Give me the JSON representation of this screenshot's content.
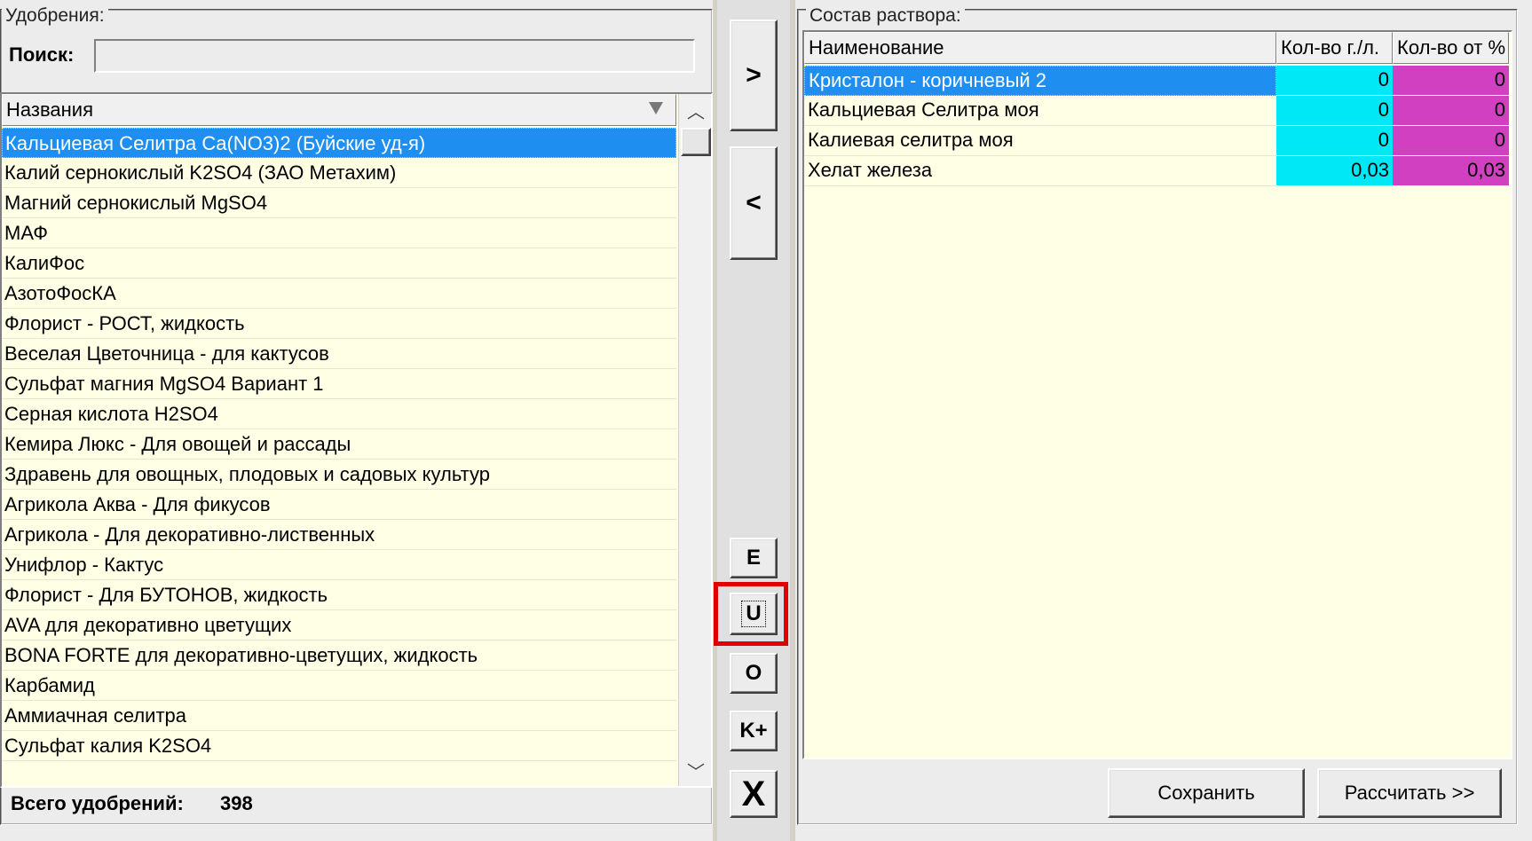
{
  "left": {
    "group_title": "Удобрения:",
    "search_label": "Поиск:",
    "search_value": "",
    "column_header": "Названия",
    "items": [
      "Кальциевая Селитра Ca(NO3)2 (Буйские уд-я)",
      "Калий  сернокислый  K2SO4 (ЗАО Метахим)",
      "Магний сернокислый MgSO4",
      "МАФ",
      "КалиФос",
      "АзотоФосКА",
      "Флорист - РОСТ, жидкость",
      "Веселая Цветочница - для кактусов",
      "Сульфат магния MgSO4 Вариант 1",
      "Серная кислота H2SO4",
      "Кемира Люкс - Для овощей и рассады",
      "Здравень для овощных, плодовых и садовых культур",
      "Агрикола Аква - Для фикусов",
      "Агрикола - Для декоративно-лиственных",
      "Унифлор - Кактус",
      "Флорист - Для БУТОНОВ, жидкость",
      "AVA для декоративно цветущих",
      "BONA FORTE для декоративно-цветущих, жидкость",
      "Карбамид",
      "Аммиачная селитра",
      "Сульфат калия K2SO4"
    ],
    "total_label": "Всего удобрений:",
    "total_value": "398"
  },
  "middle": {
    "add_label": ">",
    "remove_label": "<",
    "e_label": "E",
    "u_label": "U",
    "o_label": "O",
    "kplus_label": "K+",
    "close_label": "X"
  },
  "right": {
    "group_title": "Состав раствора:",
    "columns": [
      "Наименование",
      "Кол-во г./л.",
      "Кол-во от %"
    ],
    "rows": [
      {
        "name": "Кристалон - коричневый 2",
        "qty": "0",
        "pct": "0"
      },
      {
        "name": "Кальциевая Селитра моя",
        "qty": "0",
        "pct": "0"
      },
      {
        "name": "Калиевая селитра моя",
        "qty": "0",
        "pct": "0"
      },
      {
        "name": "Хелат железа",
        "qty": "0,03",
        "pct": "0,03"
      }
    ],
    "save_label": "Сохранить",
    "calc_label": "Рассчитать >>"
  },
  "colors": {
    "list_bg": "#ffffe6",
    "selection": "#1e8ff0",
    "qty_cell": "#00e8f5",
    "pct_cell": "#d040c0",
    "highlight_box": "#e00000"
  }
}
